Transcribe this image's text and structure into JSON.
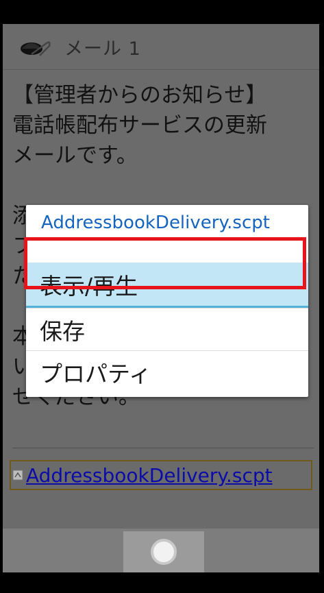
{
  "header": {
    "title": "メール 1",
    "icon": "mail-attachment-icon"
  },
  "body": {
    "text": "【管理者からのお知らせ】\n電話帳配布サービスの更新\nメールです。\n\n添\nフ\nた\n\n本\nい\nせください。"
  },
  "attachment": {
    "label": "AddressbookDelivery.scpt",
    "icon": "attachment-file-icon"
  },
  "context_menu": {
    "title": "AddressbookDelivery.scpt",
    "items": [
      {
        "label": "表示/再生",
        "selected": true
      },
      {
        "label": "保存"
      },
      {
        "label": "プロパティ"
      }
    ]
  },
  "bottom_bar": {
    "home_icon": "home-button-icon"
  },
  "colors": {
    "highlight": "#e8141b",
    "selected_bg": "#c2e6f5",
    "link": "#0c0ca8",
    "menu_title": "#1565c0"
  }
}
